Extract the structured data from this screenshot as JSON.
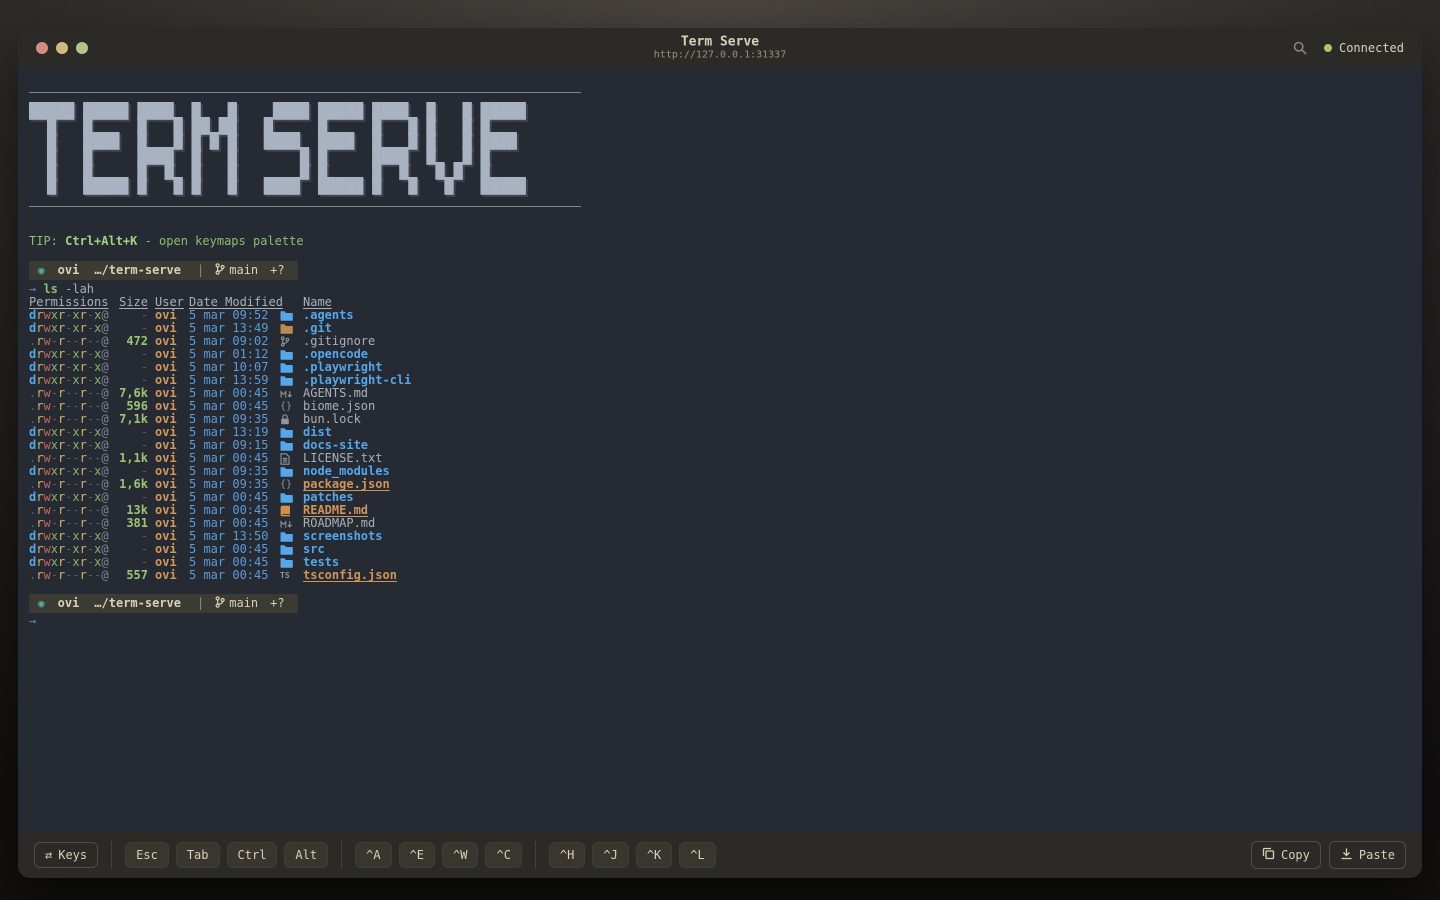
{
  "window": {
    "title": "Term Serve",
    "url": "http://127.0.0.1:31337",
    "status_label": "Connected"
  },
  "banner": {
    "lines": [
      "█████ █████ ████  █   █    ████ █████ ████  █   █ █████",
      "  █   █     █   █ ██ ██   █     █     █   █ █   █ █    ",
      "  █   ████  █   █ █ █ █   ████  ████  █   █ █   █ ████ ",
      "  █   █     ████  █   █       █ █     ████  █   █ █    ",
      "  █   █     █  █  █   █       █ █     █  █   █ █  █    ",
      "  █   █████ █   █ █   █   ████  █████ █   █   █   █████"
    ]
  },
  "tip": {
    "prefix": "TIP: ",
    "hotkey": "Ctrl+Alt+K",
    "rest": " - open keymaps palette"
  },
  "prompt": {
    "os_icon": "◉",
    "user": "ovi",
    "path": "…/term-serve",
    "separator": "|",
    "branch": "main",
    "flags": "+?"
  },
  "command": {
    "arrow": "→ ",
    "cmd": "ls",
    "args": " -lah"
  },
  "continuation": {
    "arrow": "→"
  },
  "listing": {
    "headers": [
      "Permissions",
      "Size",
      "User",
      "Date Modified",
      "Name"
    ],
    "rows": [
      {
        "perms": "drwxr-xr-x@",
        "size": "-",
        "user": "ovi",
        "date": "5 mar 09:52",
        "icon": "folder",
        "name": ".agents",
        "style": "dir"
      },
      {
        "perms": "drwxr-xr-x@",
        "size": "-",
        "user": "ovi",
        "date": "5 mar 13:49",
        "icon": "folder-git",
        "name": ".git",
        "style": "dir"
      },
      {
        "perms": ".rw-r--r--@",
        "size": "472",
        "user": "ovi",
        "date": "5 mar 09:02",
        "icon": "branch",
        "name": ".gitignore",
        "style": "file"
      },
      {
        "perms": "drwxr-xr-x@",
        "size": "-",
        "user": "ovi",
        "date": "5 mar 01:12",
        "icon": "folder",
        "name": ".opencode",
        "style": "dir"
      },
      {
        "perms": "drwxr-xr-x@",
        "size": "-",
        "user": "ovi",
        "date": "5 mar 10:07",
        "icon": "folder",
        "name": ".playwright",
        "style": "dir"
      },
      {
        "perms": "drwxr-xr-x@",
        "size": "-",
        "user": "ovi",
        "date": "5 mar 13:59",
        "icon": "folder",
        "name": ".playwright-cli",
        "style": "dir"
      },
      {
        "perms": ".rw-r--r--@",
        "size": "7,6k",
        "user": "ovi",
        "date": "5 mar 00:45",
        "icon": "markdown",
        "name": "AGENTS.md",
        "style": "file"
      },
      {
        "perms": ".rw-r--r--@",
        "size": "596",
        "user": "ovi",
        "date": "5 mar 00:45",
        "icon": "braces",
        "name": "biome.json",
        "style": "file"
      },
      {
        "perms": ".rw-r--r--@",
        "size": "7,1k",
        "user": "ovi",
        "date": "5 mar 09:35",
        "icon": "lock",
        "name": "bun.lock",
        "style": "file"
      },
      {
        "perms": "drwxr-xr-x@",
        "size": "-",
        "user": "ovi",
        "date": "5 mar 13:19",
        "icon": "folder",
        "name": "dist",
        "style": "dir"
      },
      {
        "perms": "drwxr-xr-x@",
        "size": "-",
        "user": "ovi",
        "date": "5 mar 09:15",
        "icon": "folder",
        "name": "docs-site",
        "style": "dir"
      },
      {
        "perms": ".rw-r--r--@",
        "size": "1,1k",
        "user": "ovi",
        "date": "5 mar 00:45",
        "icon": "doc",
        "name": "LICENSE.txt",
        "style": "file"
      },
      {
        "perms": "drwxr-xr-x@",
        "size": "-",
        "user": "ovi",
        "date": "5 mar 09:35",
        "icon": "folder",
        "name": "node_modules",
        "style": "dir"
      },
      {
        "perms": ".rw-r--r--@",
        "size": "1,6k",
        "user": "ovi",
        "date": "5 mar 09:35",
        "icon": "braces",
        "name": "package.json",
        "style": "highlight"
      },
      {
        "perms": "drwxr-xr-x@",
        "size": "-",
        "user": "ovi",
        "date": "5 mar 00:45",
        "icon": "folder",
        "name": "patches",
        "style": "dir"
      },
      {
        "perms": ".rw-r--r--@",
        "size": "13k",
        "user": "ovi",
        "date": "5 mar 00:45",
        "icon": "book",
        "name": "README.md",
        "style": "highlight"
      },
      {
        "perms": ".rw-r--r--@",
        "size": "381",
        "user": "ovi",
        "date": "5 mar 00:45",
        "icon": "markdown",
        "name": "ROADMAP.md",
        "style": "file"
      },
      {
        "perms": "drwxr-xr-x@",
        "size": "-",
        "user": "ovi",
        "date": "5 mar 13:50",
        "icon": "folder",
        "name": "screenshots",
        "style": "dir"
      },
      {
        "perms": "drwxr-xr-x@",
        "size": "-",
        "user": "ovi",
        "date": "5 mar 00:45",
        "icon": "folder",
        "name": "src",
        "style": "dir"
      },
      {
        "perms": "drwxr-xr-x@",
        "size": "-",
        "user": "ovi",
        "date": "5 mar 00:45",
        "icon": "folder",
        "name": "tests",
        "style": "dir"
      },
      {
        "perms": ".rw-r--r--@",
        "size": "557",
        "user": "ovi",
        "date": "5 mar 00:45",
        "icon": "ts",
        "name": "tsconfig.json",
        "style": "highlight"
      }
    ]
  },
  "footer": {
    "keys_label": "Keys",
    "key_groups": [
      [
        "Esc",
        "Tab",
        "Ctrl",
        "Alt"
      ],
      [
        "^A",
        "^E",
        "^W",
        "^C"
      ],
      [
        "^H",
        "^J",
        "^K",
        "^L"
      ]
    ],
    "copy_label": "Copy",
    "paste_label": "Paste"
  },
  "colors": {
    "terminal_bg": "#252a33",
    "chrome_bg": "#2b2a27",
    "cream_text": "#d8d2ba",
    "dir_blue": "#54a7ea",
    "date_blue": "#5b9bd8",
    "size_green": "#9cc474",
    "tip_green": "#8cbe70",
    "user_orange": "#d2985c",
    "highlight_orange": "#cf9458",
    "perm_red": "#c9655f",
    "perm_yellow": "#d3b469",
    "status_green": "#a9c46a",
    "prompt_bar_bg": "#3b3a33",
    "banner_gray": "#a9b2c1"
  }
}
